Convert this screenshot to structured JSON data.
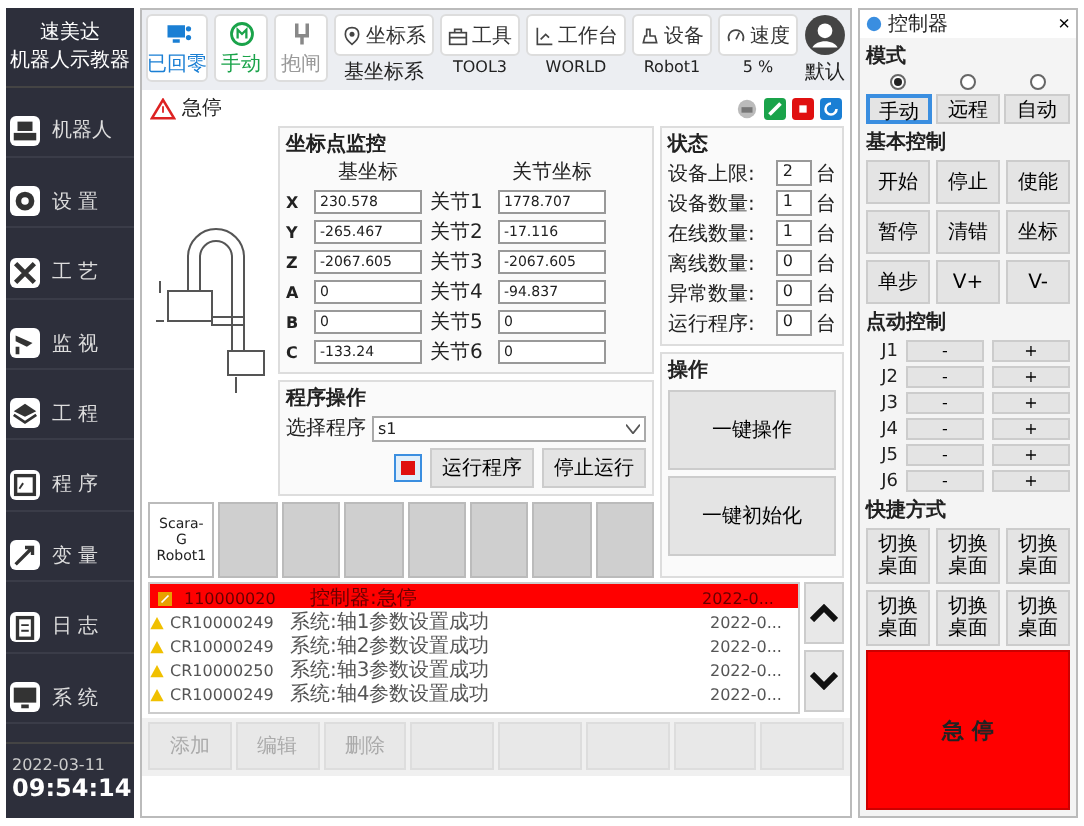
{
  "sidebar": {
    "brand": "速美达",
    "title": "机器人示教器",
    "items": [
      {
        "label": "机器人"
      },
      {
        "label": "设 置"
      },
      {
        "label": "工 艺"
      },
      {
        "label": "监 视"
      },
      {
        "label": "工 程"
      },
      {
        "label": "程 序"
      },
      {
        "label": "变 量"
      },
      {
        "label": "日 志"
      },
      {
        "label": "系 统"
      }
    ],
    "date": "2022-03-11",
    "time": "09:54:14"
  },
  "toolbar": {
    "status_tiles": [
      {
        "label": "已回零",
        "kind": "homed"
      },
      {
        "label": "手动",
        "kind": "manual"
      },
      {
        "label": "抱闸",
        "kind": "brake"
      }
    ],
    "selectors": [
      {
        "label": "坐标系",
        "value": "基坐标系"
      },
      {
        "label": "工具",
        "value": "TOOL3"
      },
      {
        "label": "工作台",
        "value": "WORLD"
      },
      {
        "label": "设备",
        "value": "Robot1"
      },
      {
        "label": "速度",
        "value": "5 %"
      }
    ],
    "user": {
      "value": "默认"
    }
  },
  "alarm_bar": {
    "text": "急停"
  },
  "coordinates": {
    "title": "坐标点监控",
    "base_header": "基坐标",
    "joint_header": "关节坐标",
    "rows": [
      {
        "axis": "X",
        "base": "230.578",
        "joint_label": "关节1",
        "joint": "1778.707"
      },
      {
        "axis": "Y",
        "base": "-265.467",
        "joint_label": "关节2",
        "joint": "-17.116"
      },
      {
        "axis": "Z",
        "base": "-2067.605",
        "joint_label": "关节3",
        "joint": "-2067.605"
      },
      {
        "axis": "A",
        "base": "0",
        "joint_label": "关节4",
        "joint": "-94.837"
      },
      {
        "axis": "B",
        "base": "0",
        "joint_label": "关节5",
        "joint": "0"
      },
      {
        "axis": "C",
        "base": "-133.24",
        "joint_label": "关节6",
        "joint": "0"
      }
    ]
  },
  "status": {
    "title": "状态",
    "rows": [
      {
        "label": "设备上限:",
        "value": "2",
        "unit": "台"
      },
      {
        "label": "设备数量:",
        "value": "1",
        "unit": "台"
      },
      {
        "label": "在线数量:",
        "value": "1",
        "unit": "台"
      },
      {
        "label": "离线数量:",
        "value": "0",
        "unit": "台"
      },
      {
        "label": "异常数量:",
        "value": "0",
        "unit": "台"
      },
      {
        "label": "运行程序:",
        "value": "0",
        "unit": "台"
      }
    ]
  },
  "program": {
    "title": "程序操作",
    "select_label": "选择程序",
    "selected_program": "s1",
    "buttons": [
      "运行程序",
      "停止运行"
    ]
  },
  "operations": {
    "title": "操作",
    "buttons": [
      "一键操作",
      "一键初始化"
    ]
  },
  "tiles": [
    {
      "kind": "robot",
      "label": "Scara-G Robot1"
    },
    {
      "kind": "empty"
    },
    {
      "kind": "empty"
    },
    {
      "kind": "empty"
    },
    {
      "kind": "empty"
    },
    {
      "kind": "empty"
    },
    {
      "kind": "empty"
    },
    {
      "kind": "empty"
    }
  ],
  "log": [
    {
      "kind": "alarm",
      "code": "110000020",
      "message": "控制器:急停",
      "time": "2022-0..."
    },
    {
      "kind": "warning",
      "code": "CR10000249",
      "message": "系统:轴1参数设置成功",
      "time": "2022-0..."
    },
    {
      "kind": "warning",
      "code": "CR10000249",
      "message": "系统:轴2参数设置成功",
      "time": "2022-0..."
    },
    {
      "kind": "warning",
      "code": "CR10000250",
      "message": "系统:轴3参数设置成功",
      "time": "2022-0..."
    },
    {
      "kind": "warning",
      "code": "CR10000249",
      "message": "系统:轴4参数设置成功",
      "time": "2022-0..."
    }
  ],
  "actions": [
    {
      "kind": "button",
      "label": "添加",
      "disabled": true
    },
    {
      "kind": "button",
      "label": "编辑",
      "disabled": true
    },
    {
      "kind": "button",
      "label": "删除",
      "disabled": true
    },
    {
      "kind": "empty"
    },
    {
      "kind": "empty"
    },
    {
      "kind": "empty"
    },
    {
      "kind": "empty"
    },
    {
      "kind": "empty"
    }
  ],
  "controller": {
    "title": "控制器",
    "close": "×",
    "modes_title": "模式",
    "modes": [
      {
        "label": "手动",
        "selected": true
      },
      {
        "label": "远程",
        "selected": false
      },
      {
        "label": "自动",
        "selected": false
      }
    ],
    "basic_title": "基本控制",
    "basic": [
      "开始",
      "停止",
      "使能",
      "暂停",
      "清错",
      "坐标",
      "单步",
      "V+",
      "V-"
    ],
    "jog_title": "点动控制",
    "jog": [
      {
        "label": "J1",
        "minus": "-",
        "plus": "+"
      },
      {
        "label": "J2",
        "minus": "-",
        "plus": "+"
      },
      {
        "label": "J3",
        "minus": "-",
        "plus": "+"
      },
      {
        "label": "J4",
        "minus": "-",
        "plus": "+"
      },
      {
        "label": "J5",
        "minus": "-",
        "plus": "+"
      },
      {
        "label": "J6",
        "minus": "-",
        "plus": "+"
      }
    ],
    "shortcut_title": "快捷方式",
    "shortcuts": [
      "切换桌面",
      "切换桌面",
      "切换桌面",
      "切换桌面",
      "切换桌面",
      "切换桌面"
    ],
    "estop": "急 停"
  }
}
